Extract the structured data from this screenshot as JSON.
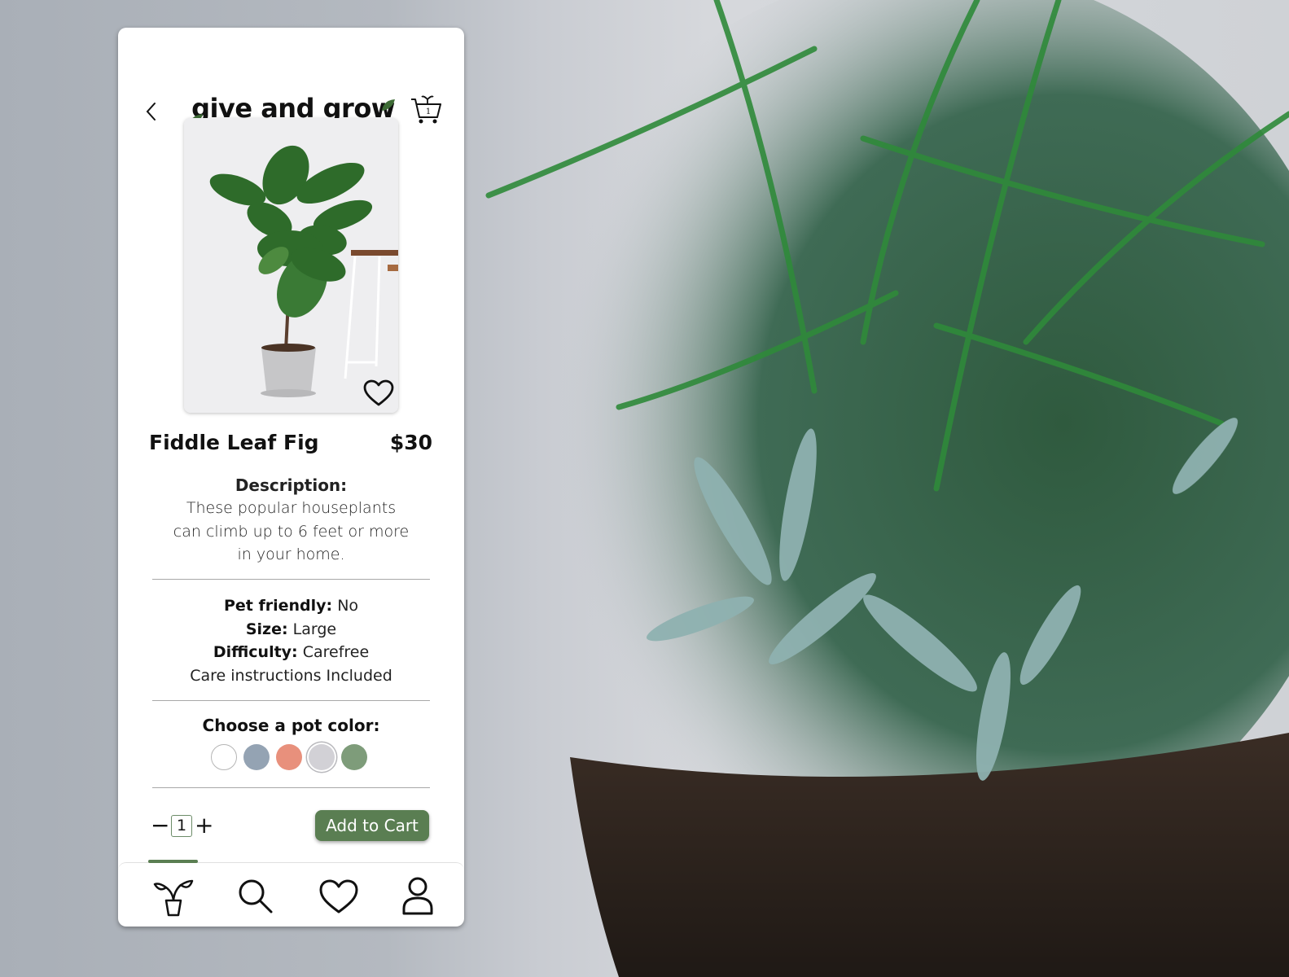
{
  "app": {
    "brand": "give and grow",
    "cart_count": "1"
  },
  "header": {
    "back_icon": "chevron-left-icon",
    "cart_icon": "plant-cart-icon"
  },
  "product": {
    "name": "Fiddle Leaf Fig",
    "price": "$30",
    "image_alt": "Fiddle leaf fig in grey pot",
    "favorite_icon": "heart-outline-icon",
    "description_label": "Description:",
    "description_lines": [
      "These popular houseplants",
      "can climb up to 6 feet or more",
      "in your home."
    ],
    "specs": {
      "pet_friendly_label": "Pet friendly:",
      "pet_friendly_value": "No",
      "size_label": "Size:",
      "size_value": "Large",
      "difficulty_label": "Difficulty:",
      "difficulty_value": "Carefree",
      "care_note": "Care instructions Included"
    }
  },
  "pot_colors": {
    "label": "Choose a pot color:",
    "options": [
      {
        "name": "white",
        "hex": "#ffffff",
        "selected": false
      },
      {
        "name": "slate blue",
        "hex": "#94a3b3",
        "selected": false
      },
      {
        "name": "coral",
        "hex": "#e8907c",
        "selected": false
      },
      {
        "name": "light grey",
        "hex": "#d2d1d6",
        "selected": true
      },
      {
        "name": "sage green",
        "hex": "#7e9c7a",
        "selected": false
      }
    ]
  },
  "purchase": {
    "quantity": "1",
    "minus": "−",
    "plus": "+",
    "add_to_cart_label": "Add to Cart"
  },
  "tabbar": {
    "active": "plants",
    "items": [
      {
        "name": "plants",
        "icon": "potted-plant-icon"
      },
      {
        "name": "search",
        "icon": "search-icon"
      },
      {
        "name": "favorites",
        "icon": "heart-icon"
      },
      {
        "name": "profile",
        "icon": "user-icon"
      }
    ]
  },
  "colors": {
    "accent": "#5a7e52",
    "text": "#111111"
  }
}
